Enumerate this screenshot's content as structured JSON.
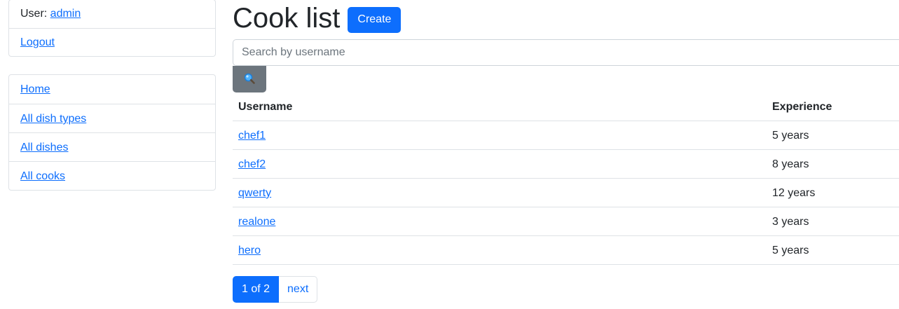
{
  "sidebar": {
    "user_prefix": "User: ",
    "username": "admin",
    "logout": "Logout",
    "nav": [
      {
        "label": "Home"
      },
      {
        "label": "All dish types"
      },
      {
        "label": "All dishes"
      },
      {
        "label": "All cooks"
      }
    ]
  },
  "main": {
    "title": "Cook list",
    "create_label": "Create",
    "search": {
      "placeholder": "Search by username",
      "value": "",
      "icon": "search-icon"
    },
    "table": {
      "headers": [
        "Username",
        "Experience"
      ],
      "rows": [
        {
          "username": "chef1",
          "experience": "5 years"
        },
        {
          "username": "chef2",
          "experience": "8 years"
        },
        {
          "username": "qwerty",
          "experience": "12 years"
        },
        {
          "username": "realone",
          "experience": "3 years"
        },
        {
          "username": "hero",
          "experience": "5 years"
        }
      ]
    },
    "pagination": {
      "current": "1 of 2",
      "next": "next"
    }
  },
  "colors": {
    "primary": "#0d6efd",
    "secondary": "#6c757d",
    "border": "#dee2e6",
    "text": "#212529"
  }
}
